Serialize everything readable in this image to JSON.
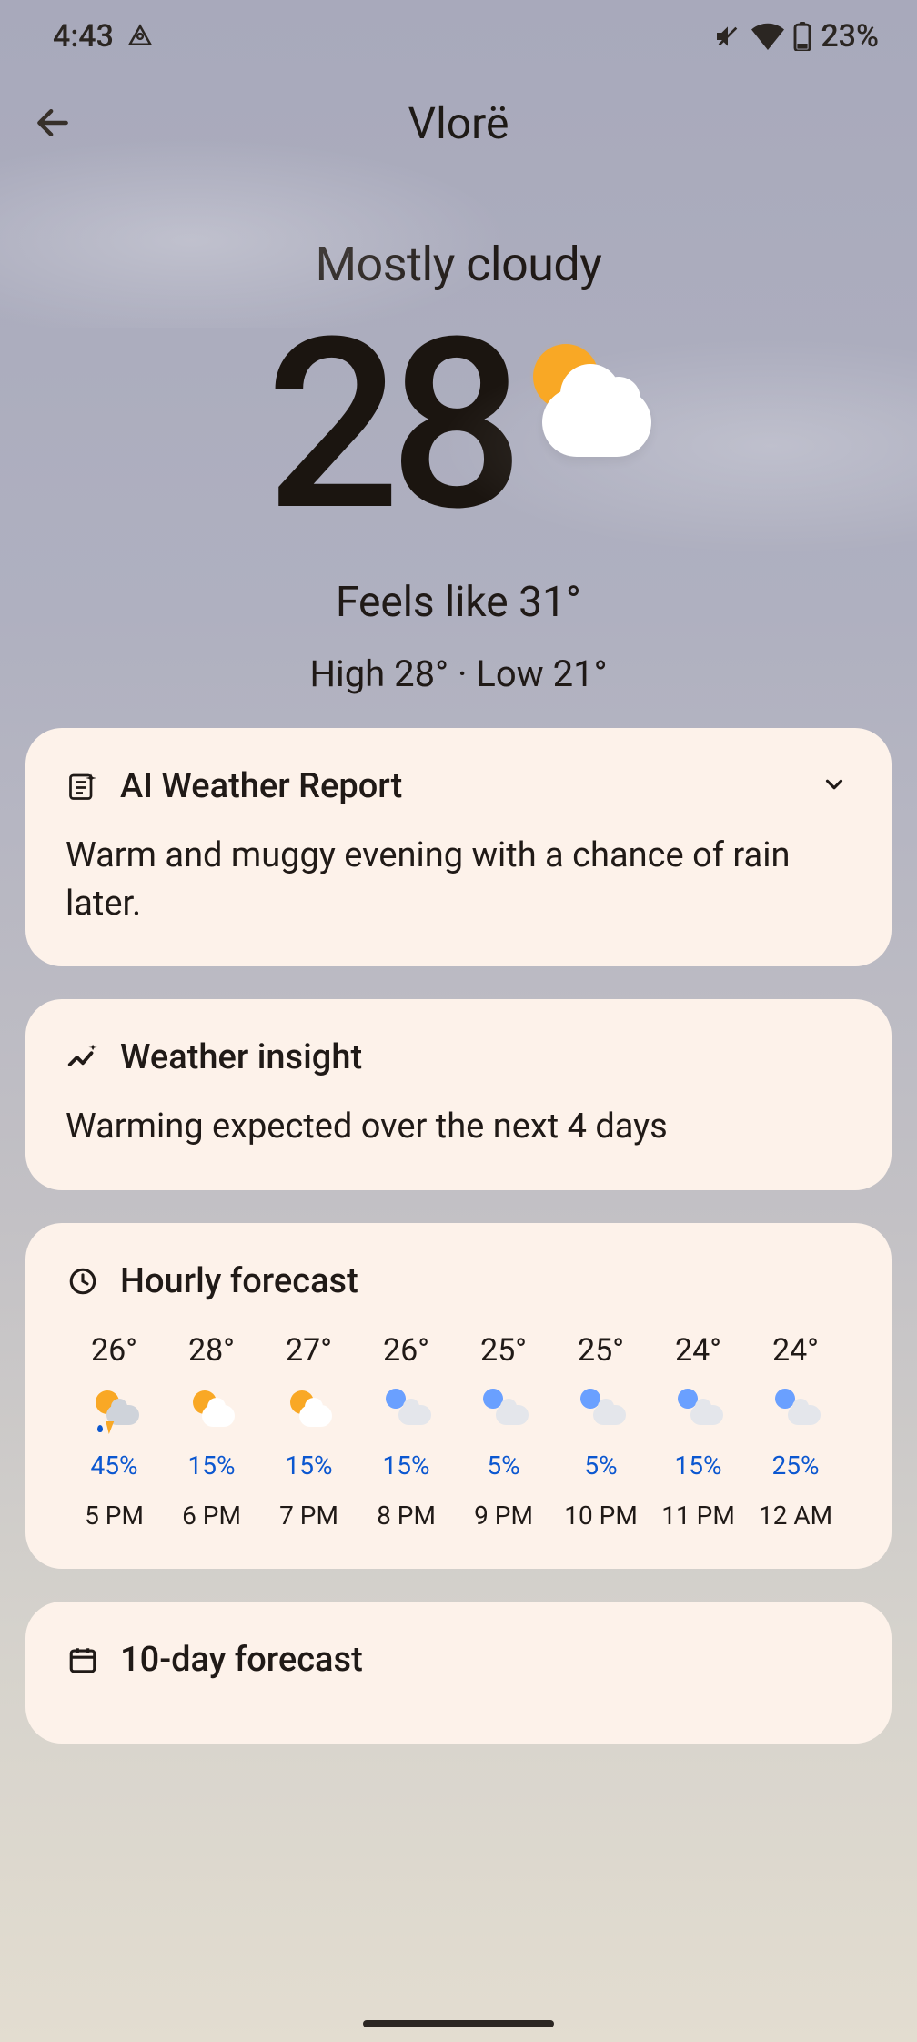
{
  "status_bar": {
    "time": "4:43",
    "battery_pct": "23%"
  },
  "header": {
    "location": "Vlorë"
  },
  "hero": {
    "condition": "Mostly cloudy",
    "temp": "28",
    "feels_like": "Feels like 31°",
    "high_low": "High 28° · Low 21°"
  },
  "ai_report": {
    "title": "AI Weather Report",
    "body": "Warm and muggy evening with a chance of rain later."
  },
  "insight": {
    "title": "Weather insight",
    "body": "Warming expected over the next 4 days"
  },
  "hourly": {
    "title": "Hourly forecast",
    "items": [
      {
        "temp": "26°",
        "icon": "storm",
        "precip": "45%",
        "label": "5 PM"
      },
      {
        "temp": "28°",
        "icon": "partly-sunny",
        "precip": "15%",
        "label": "6 PM"
      },
      {
        "temp": "27°",
        "icon": "partly-sunny",
        "precip": "15%",
        "label": "7 PM"
      },
      {
        "temp": "26°",
        "icon": "night-cloud",
        "precip": "15%",
        "label": "8 PM"
      },
      {
        "temp": "25°",
        "icon": "night-cloud",
        "precip": "5%",
        "label": "9 PM"
      },
      {
        "temp": "25°",
        "icon": "night-cloud",
        "precip": "5%",
        "label": "10 PM"
      },
      {
        "temp": "24°",
        "icon": "night-cloud",
        "precip": "15%",
        "label": "11 PM"
      },
      {
        "temp": "24°",
        "icon": "night-cloud",
        "precip": "25%",
        "label": "12 AM"
      }
    ]
  },
  "tenday": {
    "title": "10-day forecast"
  },
  "colors": {
    "card_bg": "#fdf2ea",
    "text": "#201a17",
    "precip": "#0b57d0",
    "sun": "#f9a825"
  }
}
